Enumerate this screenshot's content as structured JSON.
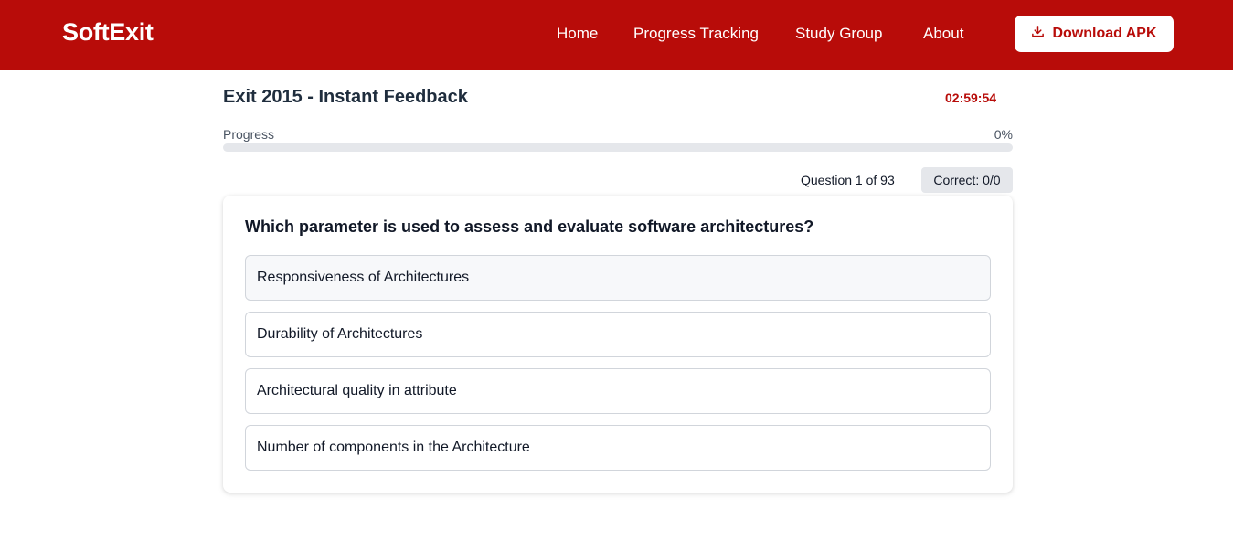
{
  "navbar": {
    "brand": "SoftExit",
    "links": [
      "Home",
      "Progress Tracking",
      "Study Group",
      "About"
    ],
    "download_label": "Download APK",
    "download_icon": "download-icon",
    "brand_color": "#b80c09"
  },
  "quiz": {
    "title": "Exit 2015 - Instant Feedback",
    "timer": "02:59:54",
    "progress_label": "Progress",
    "progress_percent_text": "0%",
    "progress_value": 0,
    "question_counter": "Question 1 of 93",
    "correct_badge": "Correct: 0/0"
  },
  "question": {
    "text": "Which parameter is used to assess and evaluate software architectures?",
    "options": [
      "Responsiveness of Architectures",
      "Durability of Architectures",
      "Architectural quality in attribute",
      "Number of components in the Architecture"
    ]
  }
}
